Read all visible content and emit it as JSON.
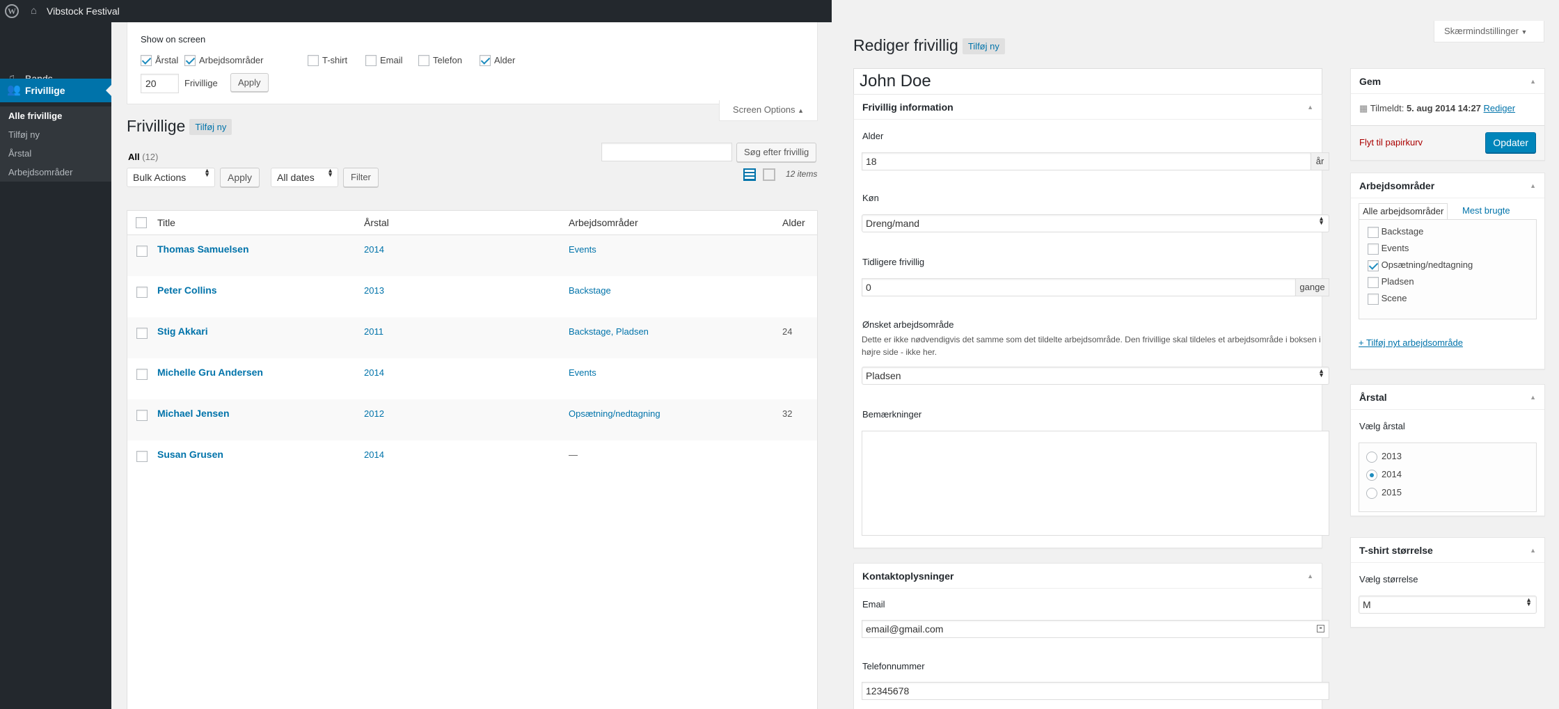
{
  "adminbar": {
    "site_name": "Vibstock Festival",
    "wp_logo": "wordpress-logo-icon",
    "home_icon": "home-icon"
  },
  "sidebar": {
    "items": [
      {
        "label": "Bands",
        "icon": "music-note-icon"
      },
      {
        "label": "Frivillige",
        "icon": "groups-icon"
      }
    ],
    "submenu": [
      "Alle frivillige",
      "Tilføj ny",
      "Årstal",
      "Arbejdsområder"
    ]
  },
  "screen_options": {
    "heading": "Show on screen",
    "columns": [
      {
        "label": "Årstal",
        "checked": true
      },
      {
        "label": "Arbejdsområder",
        "checked": true
      },
      {
        "label": "T-shirt",
        "checked": false
      },
      {
        "label": "Email",
        "checked": false
      },
      {
        "label": "Telefon",
        "checked": false
      },
      {
        "label": "Alder",
        "checked": true
      }
    ],
    "per_page": "20",
    "per_page_label": "Frivillige",
    "apply": "Apply",
    "tab_label": "Screen Options"
  },
  "list": {
    "title": "Frivillige",
    "add_new": "Tilføj ny",
    "all_label": "All",
    "all_count": "(12)",
    "search_button": "Søg efter frivillig",
    "bulk_actions": "Bulk Actions",
    "apply": "Apply",
    "all_dates": "All dates",
    "filter": "Filter",
    "items_count": "12 items",
    "columns": [
      "Title",
      "Årstal",
      "Arbejdsområder",
      "Alder"
    ],
    "rows": [
      {
        "title": "Thomas Samuelsen",
        "year": "2014",
        "areas": "Events",
        "age": ""
      },
      {
        "title": "Peter Collins",
        "year": "2013",
        "areas": "Backstage",
        "age": ""
      },
      {
        "title": "Stig Akkari",
        "year": "2011",
        "areas": "Backstage, Pladsen",
        "age": "24"
      },
      {
        "title": "Michelle Gru Andersen",
        "year": "2014",
        "areas": "Events",
        "age": ""
      },
      {
        "title": "Michael Jensen",
        "year": "2012",
        "areas": "Opsætning/nedtagning",
        "age": "32"
      },
      {
        "title": "Susan Grusen",
        "year": "2014",
        "areas": "—",
        "age": ""
      }
    ]
  },
  "edit": {
    "screen_options": "Skærmindstillinger",
    "title": "Rediger frivillig",
    "add_new": "Tilføj ny",
    "name": "John Doe",
    "info_box": {
      "title": "Frivillig information",
      "age_label": "Alder",
      "age_value": "18",
      "age_unit": "år",
      "gender_label": "Køn",
      "gender_value": "Dreng/mand",
      "previous_label": "Tidligere frivillig",
      "previous_value": "0",
      "previous_unit": "gange",
      "wish_label": "Ønsket arbejdsområde",
      "wish_desc": "Dette er ikke nødvendigvis det samme som det tildelte arbejdsområde. Den frivillige skal tildeles et arbejdsområde i boksen i højre side - ikke her.",
      "wish_value": "Pladsen",
      "notes_label": "Bemærkninger"
    },
    "contact_box": {
      "title": "Kontaktoplysninger",
      "email_label": "Email",
      "email_value": "email@gmail.com",
      "phone_label": "Telefonnummer",
      "phone_value": "12345678"
    },
    "publish_box": {
      "title": "Gem",
      "registered_label": "Tilmeldt:",
      "registered_date": "5. aug 2014 14:27",
      "edit_link": "Rediger",
      "trash_link": "Flyt til papirkurv",
      "update_button": "Opdater"
    },
    "areas_box": {
      "title": "Arbejdsområder",
      "tab_all": "Alle arbejdsområder",
      "tab_popular": "Mest brugte",
      "options": [
        {
          "label": "Backstage",
          "checked": false
        },
        {
          "label": "Events",
          "checked": false
        },
        {
          "label": "Opsætning/nedtagning",
          "checked": true
        },
        {
          "label": "Pladsen",
          "checked": false
        },
        {
          "label": "Scene",
          "checked": false
        }
      ],
      "add_link": "+ Tilføj nyt arbejdsområde"
    },
    "year_box": {
      "title": "Årstal",
      "label": "Vælg årstal",
      "options": [
        {
          "label": "2013",
          "selected": false
        },
        {
          "label": "2014",
          "selected": true
        },
        {
          "label": "2015",
          "selected": false
        }
      ]
    },
    "tshirt_box": {
      "title": "T-shirt størrelse",
      "label": "Vælg størrelse",
      "value": "M"
    }
  },
  "colors": {
    "accent": "#0073aa",
    "sidebar": "#23282d",
    "primary_button": "#0085ba",
    "trash": "#a00"
  }
}
